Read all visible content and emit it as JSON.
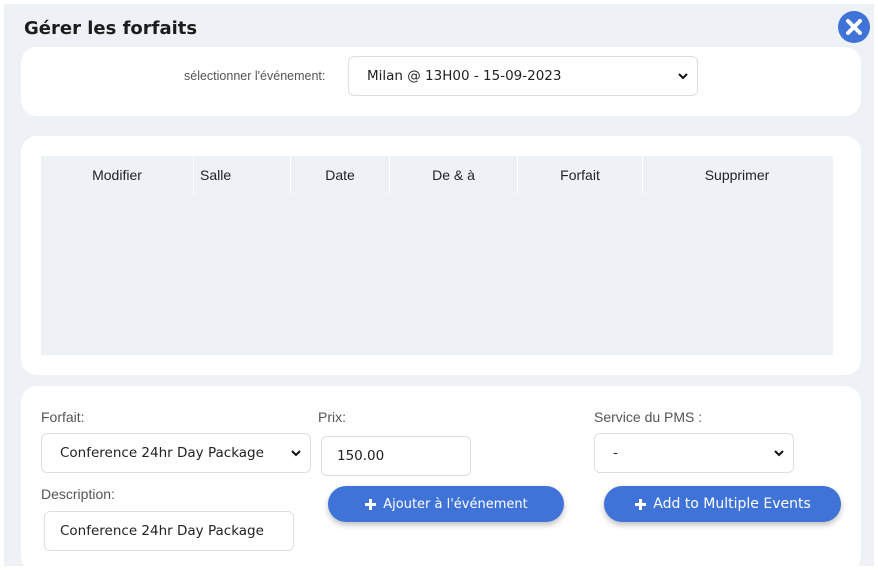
{
  "modal": {
    "title": "Gérer les forfaits"
  },
  "event_select": {
    "label": "sélectionner l'événement:",
    "selected": "Milan @ 13H00 - 15-09-2023"
  },
  "table": {
    "columns": [
      "Modifier",
      "Salle",
      "Date",
      "De & à",
      "Forfait",
      "Supprimer"
    ],
    "rows": []
  },
  "form": {
    "forfait_label": "Forfait:",
    "forfait_selected": "Conference 24hr Day Package",
    "prix_label": "Prix:",
    "prix_value": "150.00",
    "pms_label": "Service du PMS :",
    "pms_selected": "-",
    "description_label": "Description:",
    "description_value": "Conference 24hr Day Package",
    "add_button": "Ajouter à l'événement",
    "multi_button": "Add to Multiple Events"
  },
  "colors": {
    "accent": "#3f73d8",
    "panel_bg": "#eef1f6",
    "card_bg": "#ffffff"
  }
}
